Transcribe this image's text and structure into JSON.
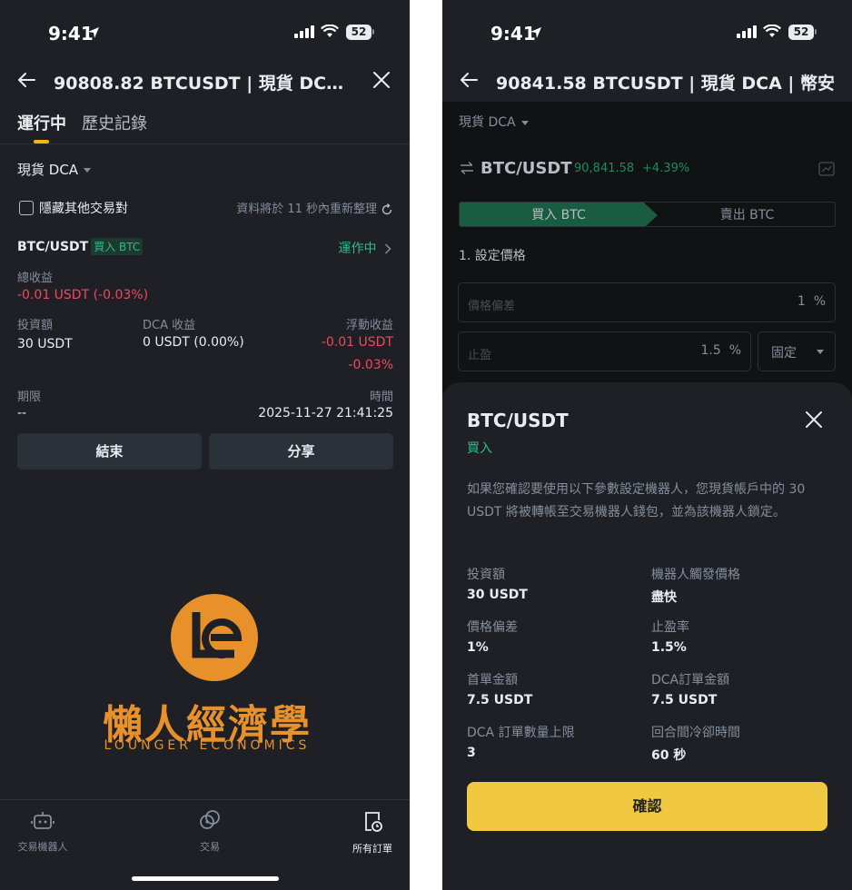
{
  "status_bar": {
    "time": "9:41",
    "battery": "52"
  },
  "left": {
    "nav_title": "90808.82 BTCUSDT | 現貨 DCA |...",
    "tabs": [
      "運行中",
      "歷史記錄"
    ],
    "strategy_dropdown": "現貨 DCA",
    "hide_pairs_label": "隱藏其他交易對",
    "refresh_note": "資料將於 11 秒內重新整理",
    "pair": "BTC/USDT",
    "side_tag": "買入 BTC",
    "run_status": "運作中",
    "total_profit_label": "總收益",
    "total_profit_value": "-0.01 USDT (-0.03%)",
    "invest_label": "投資額",
    "invest_value": "30 USDT",
    "dca_profit_label": "DCA 收益",
    "dca_profit_value": "0 USDT (0.00%)",
    "float_label": "浮動收益",
    "float_value": "-0.01 USDT",
    "float_pct": "-0.03%",
    "term_label": "期限",
    "term_value": "--",
    "time_label": "時間",
    "time_value": "2025-11-27 21:41:25",
    "end_button": "結束",
    "share_button": "分享",
    "logo_cn": "懶人經濟學",
    "logo_en": "LOUNGER ECONOMICS",
    "bottom_nav": [
      "交易機器人",
      "交易",
      "所有訂單"
    ]
  },
  "right": {
    "nav_title": "90841.58 BTCUSDT | 現貨 DCA | 幣安",
    "strategy_dropdown": "現貨 DCA",
    "pair": "BTC/USDT",
    "price": "90,841.58",
    "change": "+4.39%",
    "buy_tab": "買入 BTC",
    "sell_tab": "賣出 BTC",
    "step1": "1. 設定價格",
    "deviation_placeholder": "價格偏差",
    "deviation_value": "1",
    "tp_placeholder": "止盈",
    "tp_value": "1.5",
    "percent": "%",
    "fixed_select": "固定",
    "sheet": {
      "title": "BTC/USDT",
      "side": "買入",
      "description": "如果您確認要使用以下參數設定機器人，您現貨帳戶中的 30 USDT 將被轉帳至交易機器人錢包，並為該機器人鎖定。",
      "params": [
        {
          "label": "投資額",
          "value": "30 USDT"
        },
        {
          "label": "機器人觸發價格",
          "value": "盡快"
        },
        {
          "label": "價格偏差",
          "value": "1%"
        },
        {
          "label": "止盈率",
          "value": "1.5%"
        },
        {
          "label": "首單金額",
          "value": "7.5 USDT"
        },
        {
          "label": "DCA訂單金額",
          "value": "7.5 USDT"
        },
        {
          "label": "DCA 訂單數量上限",
          "value": "3"
        },
        {
          "label": "回合間冷卻時間",
          "value": "60 秒"
        }
      ],
      "confirm": "確認"
    }
  }
}
